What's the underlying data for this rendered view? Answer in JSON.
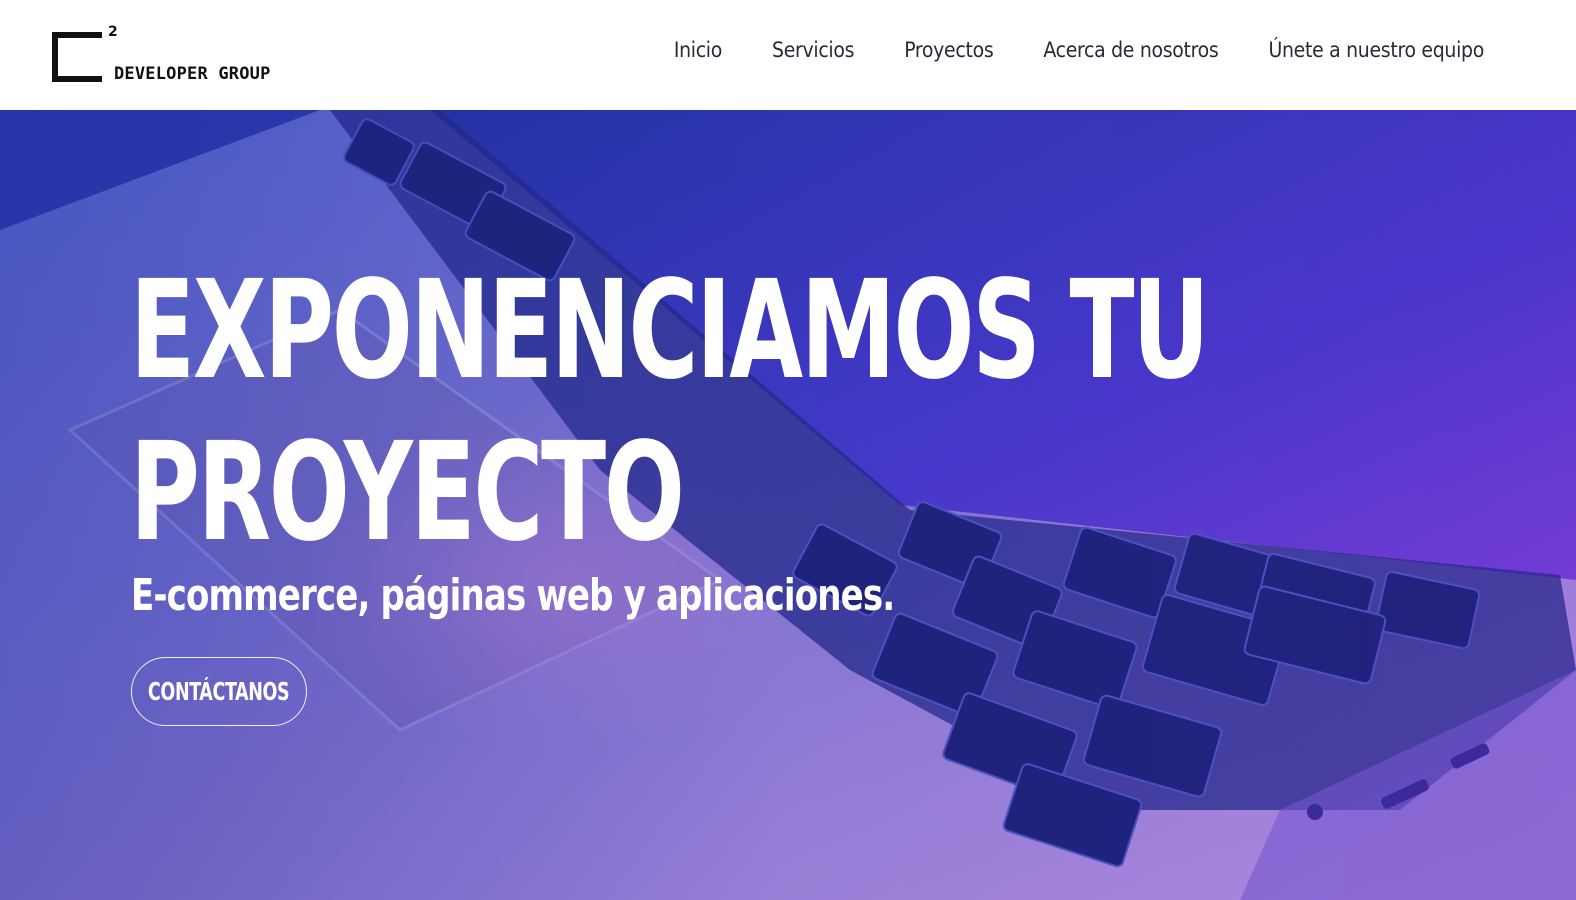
{
  "header": {
    "logo": {
      "superscript": "2",
      "text": "DEVELOPER GROUP"
    },
    "nav": [
      {
        "label": "Inicio"
      },
      {
        "label": "Servicios"
      },
      {
        "label": "Proyectos"
      },
      {
        "label": "Acerca de nosotros"
      },
      {
        "label": "Únete a nuestro equipo"
      }
    ]
  },
  "hero": {
    "title_line1": "EXPONENCIAMOS TU",
    "title_line2": "PROYECTO",
    "subtitle": "E-commerce, páginas web y aplicaciones.",
    "cta_label": "CONTÁCTANOS",
    "background_image": "laptop-keyboard-image"
  },
  "colors": {
    "header_bg": "#ffffff",
    "nav_text": "#2a2a3a",
    "hero_blue": "#2a3bb8",
    "hero_purple": "#7a3ed8",
    "hero_text": "#ffffff"
  }
}
